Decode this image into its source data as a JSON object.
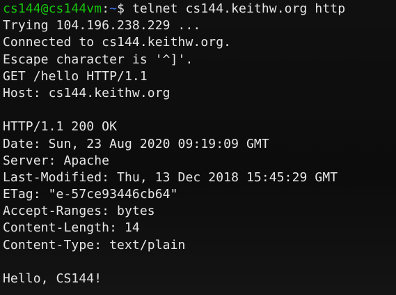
{
  "terminal": {
    "prompt": {
      "user_host": "cs144@cs144vm",
      "separator": ":",
      "path": "~",
      "symbol": "$ ",
      "command": "telnet cs144.keithw.org http"
    },
    "lines": [
      "Trying 104.196.238.229 ...",
      "Connected to cs144.keithw.org.",
      "Escape character is '^]'.",
      "GET /hello HTTP/1.1",
      "Host: cs144.keithw.org",
      "",
      "HTTP/1.1 200 OK",
      "Date: Sun, 23 Aug 2020 09:19:09 GMT",
      "Server: Apache",
      "Last-Modified: Thu, 13 Dec 2018 15:45:29 GMT",
      "ETag: \"e-57ce93446cb64\"",
      "Accept-Ranges: bytes",
      "Content-Length: 14",
      "Content-Type: text/plain",
      "",
      "Hello, CS144!"
    ],
    "colors": {
      "background": "#0c0c0c",
      "foreground": "#e6e6e6",
      "user_host": "#16c60c",
      "path": "#3b78ff"
    }
  }
}
